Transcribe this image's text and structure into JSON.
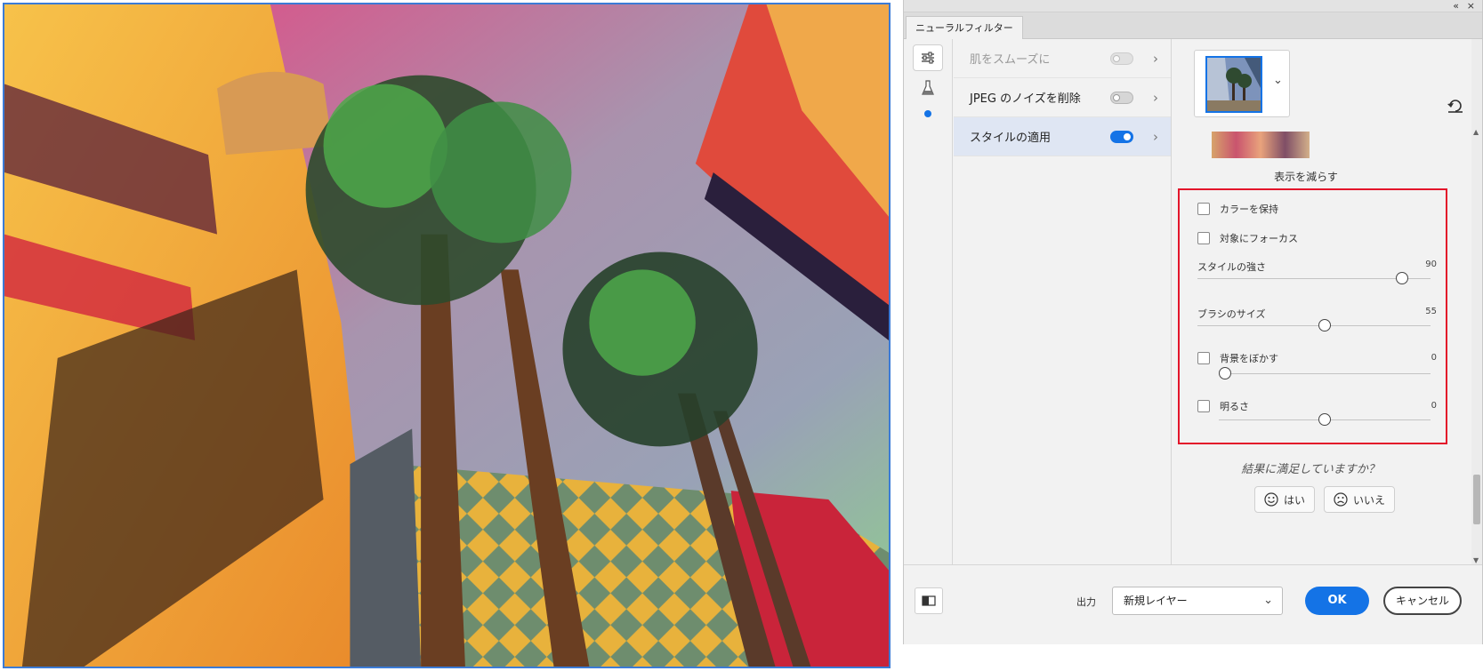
{
  "panel": {
    "tab_title": "ニューラルフィルター",
    "collapse_glyph": "«",
    "close_glyph": "×"
  },
  "filters": [
    {
      "label": "肌をスムーズに",
      "enabled": false,
      "dimmed": true
    },
    {
      "label": "JPEG のノイズを削除",
      "enabled": false,
      "dimmed": false
    },
    {
      "label": "スタイルの適用",
      "enabled": true,
      "dimmed": false,
      "active": true
    }
  ],
  "settings": {
    "reduce_display": "表示を減らす",
    "keep_color": "カラーを保持",
    "focus_subject": "対象にフォーカス",
    "style_strength": {
      "label": "スタイルの強さ",
      "value": "90",
      "fraction": 0.9
    },
    "brush_size": {
      "label": "ブラシのサイズ",
      "value": "55",
      "fraction": 0.55
    },
    "blur_background": {
      "label": "背景をぼかす",
      "value": "0",
      "fraction": 0.0
    },
    "brightness": {
      "label": "明るさ",
      "value": "0",
      "fraction": 0.5
    }
  },
  "feedback": {
    "question": "結果に満足していますか？",
    "yes": "はい",
    "no": "いいえ"
  },
  "footer": {
    "output_label": "出力",
    "output_value": "新規レイヤー",
    "ok": "OK",
    "cancel": "キャンセル"
  },
  "colors": {
    "accent": "#1473e6",
    "highlight_box": "#e3152a"
  }
}
